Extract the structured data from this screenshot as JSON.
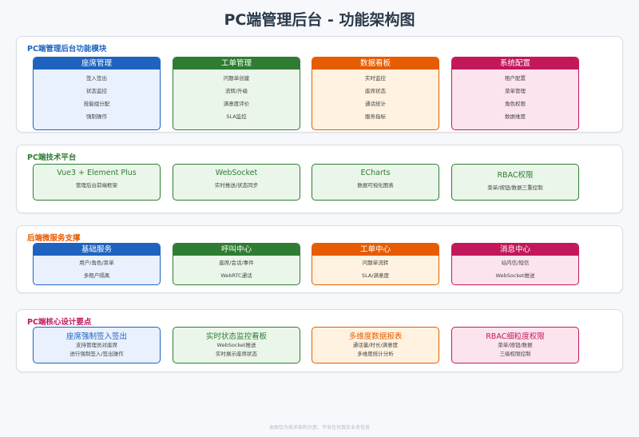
{
  "title": "PC端管理后台 - 功能架构图",
  "colors": {
    "blue": "#1f63c0",
    "green": "#2e7d32",
    "orange": "#e65c00",
    "pink": "#c2185b"
  },
  "modules": {
    "title": "PC端管理后台功能模块",
    "cards": [
      {
        "header": "座席管理",
        "items": [
          "签入签出",
          "状态监控",
          "技能组分配",
          "强制操作"
        ]
      },
      {
        "header": "工单管理",
        "items": [
          "问题单创建",
          "流转/升级",
          "满意度评价",
          "SLA监控"
        ]
      },
      {
        "header": "数据看板",
        "items": [
          "实时监控",
          "座席状态",
          "通话统计",
          "服务指标"
        ]
      },
      {
        "header": "系统配置",
        "items": [
          "租户配置",
          "菜单管理",
          "角色权限",
          "数据维度"
        ]
      }
    ]
  },
  "tech": {
    "title": "PC端技术平台",
    "cards": [
      {
        "title": "Vue3 + Element Plus",
        "desc": "管理后台前端框架"
      },
      {
        "title": "WebSocket",
        "desc": "实时推送/状态同步"
      },
      {
        "title": "ECharts",
        "desc": "数据可视化图表"
      },
      {
        "title": "RBAC权限",
        "desc": "菜单/按钮/数据三重控制"
      }
    ]
  },
  "services": {
    "title": "后端微服务支撑",
    "cards": [
      {
        "header": "基础服务",
        "items": [
          "用户/角色/菜单",
          "多租户隔离"
        ]
      },
      {
        "header": "呼叫中心",
        "items": [
          "座席/会话/事件",
          "WebRTC通话"
        ]
      },
      {
        "header": "工单中心",
        "items": [
          "问题单流转",
          "SLA/满意度"
        ]
      },
      {
        "header": "消息中心",
        "items": [
          "站内信/短信",
          "WebSocket推送"
        ]
      }
    ]
  },
  "design": {
    "title": "PC端核心设计要点",
    "cards": [
      {
        "title": "座席强制签入签出",
        "lines": [
          "支持管理员对座席",
          "进行强制签入/签出操作"
        ]
      },
      {
        "title": "实时状态监控看板",
        "lines": [
          "WebSocket推送",
          "实时展示座席状态"
        ]
      },
      {
        "title": "多维度数据报表",
        "lines": [
          "通话量/时长/满意度",
          "多维度统计分析"
        ]
      },
      {
        "title": "RBAC细粒度权限",
        "lines": [
          "菜单/按钮/数据",
          "三级权限控制"
        ]
      }
    ]
  },
  "footer": "本图仅为技术架构示意，不含任何真实业务信息"
}
